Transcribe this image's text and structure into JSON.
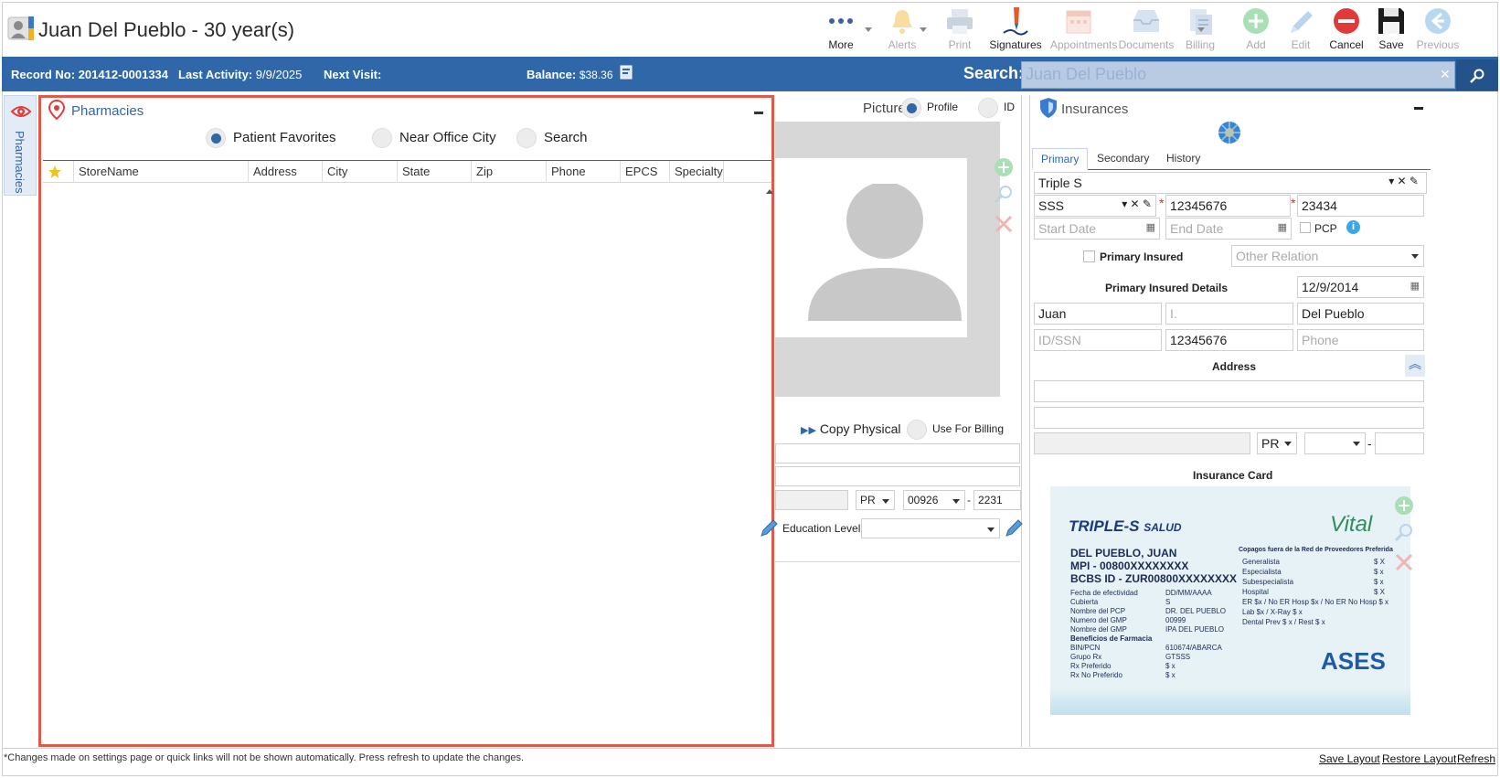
{
  "header": {
    "patient_name": "Juan Del Pueblo - 30 year(s)",
    "toolbar": [
      {
        "label": "More",
        "icon": "more-dots-icon",
        "enabled": true
      },
      {
        "label": "Alerts",
        "icon": "bell-icon",
        "enabled": false
      },
      {
        "label": "Print",
        "icon": "printer-icon",
        "enabled": false
      },
      {
        "label": "Signatures",
        "icon": "signature-pen-icon",
        "enabled": true
      },
      {
        "label": "Appointments",
        "icon": "calendar-icon",
        "enabled": false
      },
      {
        "label": "Documents",
        "icon": "inbox-tray-icon",
        "enabled": false
      },
      {
        "label": "Billing",
        "icon": "billing-sheet-icon",
        "enabled": false
      },
      {
        "label": "Add",
        "icon": "plus-circle-icon",
        "enabled": false
      },
      {
        "label": "Edit",
        "icon": "pencil-icon",
        "enabled": false
      },
      {
        "label": "Cancel",
        "icon": "cancel-circle-icon",
        "enabled": true
      },
      {
        "label": "Save",
        "icon": "floppy-disk-icon",
        "enabled": true
      },
      {
        "label": "Previous",
        "icon": "arrow-left-circle-icon",
        "enabled": false
      }
    ]
  },
  "infobar": {
    "record_label": "Record No:",
    "record_value": "201412-0001334",
    "activity_label": "Last Activity:",
    "activity_value": "9/9/2025",
    "next_visit_label": "Next Visit:",
    "balance_label": "Balance:",
    "balance_value": "$38.36",
    "search_label": "Search:",
    "search_value": "Juan Del Pueblo"
  },
  "sidetab": {
    "label": "Pharmacies"
  },
  "pharmacies": {
    "title": "Pharmacies",
    "filters": [
      {
        "label": "Patient Favorites",
        "selected": true
      },
      {
        "label": "Near Office City",
        "selected": false
      },
      {
        "label": "Search",
        "selected": false
      }
    ],
    "columns": [
      "StoreName",
      "Address",
      "City",
      "State",
      "Zip",
      "Phone",
      "EPCS",
      "Specialty"
    ],
    "rows": []
  },
  "middle": {
    "picture_label": "Picture",
    "profile_label": "Profile",
    "id_label": "ID",
    "copy_physical": "Copy Physical",
    "use_for_billing": "Use For Billing",
    "state": "PR",
    "zip": "00926",
    "zip_ext": "2231",
    "zip_dash": "-",
    "education_label": "Education Level:"
  },
  "insurances": {
    "title": "Insurances",
    "tabs": [
      "Primary",
      "Secondary",
      "History"
    ],
    "active_tab": "Primary",
    "plan": "Triple S",
    "payer": "SSS",
    "policy": "12345676",
    "group": "23434",
    "start_date_placeholder": "Start Date",
    "end_date_placeholder": "End Date",
    "pcp_label": "PCP",
    "primary_insured_label": "Primary Insured",
    "other_relation_placeholder": "Other Relation",
    "details_label": "Primary Insured Details",
    "details_date": "12/9/2014",
    "first_name": "Juan",
    "middle_placeholder": "I.",
    "last_name": "Del Pueblo",
    "idssn_placeholder": "ID/SSN",
    "idssn_value": "12345676",
    "phone_placeholder": "Phone",
    "address_label": "Address",
    "state": "PR",
    "zip_dash": "-",
    "card_label": "Insurance Card",
    "card": {
      "brand": "TRIPLE-S",
      "brand_sub": "SALUD",
      "partner": "Vital",
      "name": "DEL PUEBLO, JUAN",
      "mpi": "MPI - 00800XXXXXXXX",
      "bcbs": "BCBS ID - ZUR00800XXXXXXXX",
      "left_lines": [
        [
          "Fecha de efectividad",
          "DD/MM/AAAA"
        ],
        [
          "Cubierta",
          "S"
        ],
        [
          "Nombre del PCP",
          "DR. DEL PUEBLO"
        ],
        [
          "Numero del GMP",
          "00999"
        ],
        [
          "Nombre del GMP",
          "IPA DEL PUEBLO"
        ],
        [
          "Beneficios de Farmacia",
          ""
        ],
        [
          "BIN/PCN",
          "610674/ABARCA"
        ],
        [
          "Grupo Rx",
          "GTSSS"
        ],
        [
          "Rx Preferido",
          "$ x"
        ],
        [
          "Rx No Preferido",
          "$ x"
        ]
      ],
      "right_title": "Copagos fuera de la Red de Proveedores Preferida",
      "right_lines": [
        [
          "Generalista",
          "$ X"
        ],
        [
          "Especialista",
          "$ x"
        ],
        [
          "Subespecialista",
          "$ x"
        ],
        [
          "Hospital",
          "$ X"
        ],
        [
          "ER $x / No ER Hosp $x / No ER No Hosp $ x",
          ""
        ],
        [
          "Lab $x / X-Ray $ x",
          ""
        ],
        [
          "Dental Prev $ x / Rest $ x",
          ""
        ]
      ],
      "ases": "ASES"
    }
  },
  "footer": {
    "note": "*Changes made on settings page or quick links will not be shown automatically. Press refresh to update the changes.",
    "save_layout": "Save Layout",
    "restore_layout": "Restore Layout",
    "refresh": "Refresh"
  },
  "colors": {
    "accent": "#2f67a8",
    "highlight_border": "#e05a4b",
    "cancel": "#e03a3a",
    "add": "#5cc073"
  }
}
